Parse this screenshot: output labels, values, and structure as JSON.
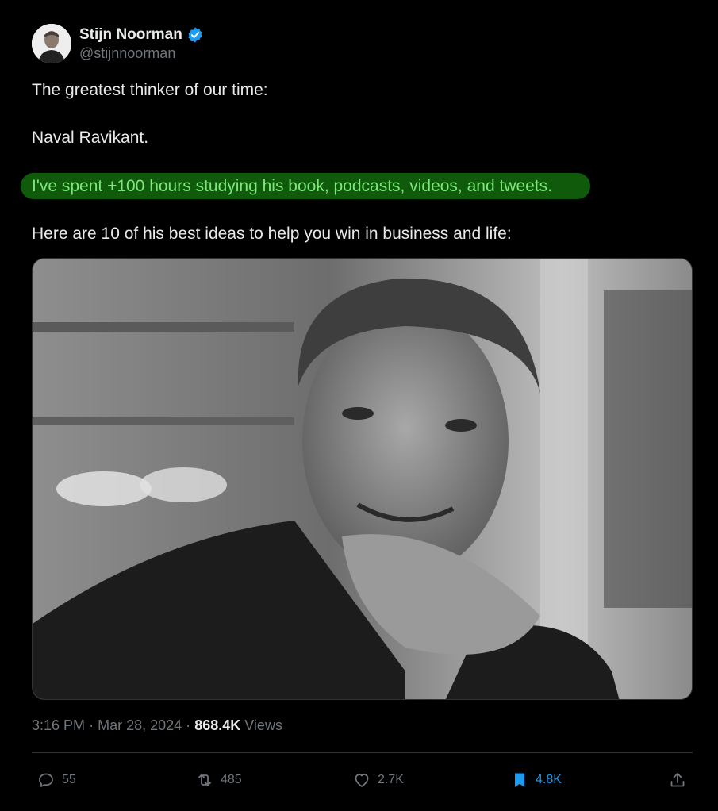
{
  "author": {
    "display_name": "Stijn Noorman",
    "handle": "@stijnnoorman",
    "verified": true
  },
  "body": {
    "line1": "The greatest thinker of our time:",
    "line2": "Naval Ravikant.",
    "highlighted_line": "I've spent +100 hours studying his book, podcasts, videos, and tweets.",
    "line4": "Here are 10 of his best ideas to help you win in business and life:"
  },
  "media": {
    "alt": "black and white portrait photo"
  },
  "meta": {
    "time": "3:16 PM",
    "separator": "·",
    "date": "Mar 28, 2024",
    "views_count": "868.4K",
    "views_label": "Views"
  },
  "actions": {
    "replies": "55",
    "reposts": "485",
    "likes": "2.7K",
    "bookmarks": "4.8K"
  },
  "colors": {
    "background": "#000000",
    "text": "#e7e9ea",
    "secondary": "#71767b",
    "accent": "#1d9bf0",
    "highlight_bg": "#0f5a0b",
    "highlight_text": "#7ee67a"
  },
  "icons": [
    "verified-badge-icon",
    "reply-icon",
    "repost-icon",
    "like-icon",
    "bookmark-icon",
    "share-icon"
  ]
}
